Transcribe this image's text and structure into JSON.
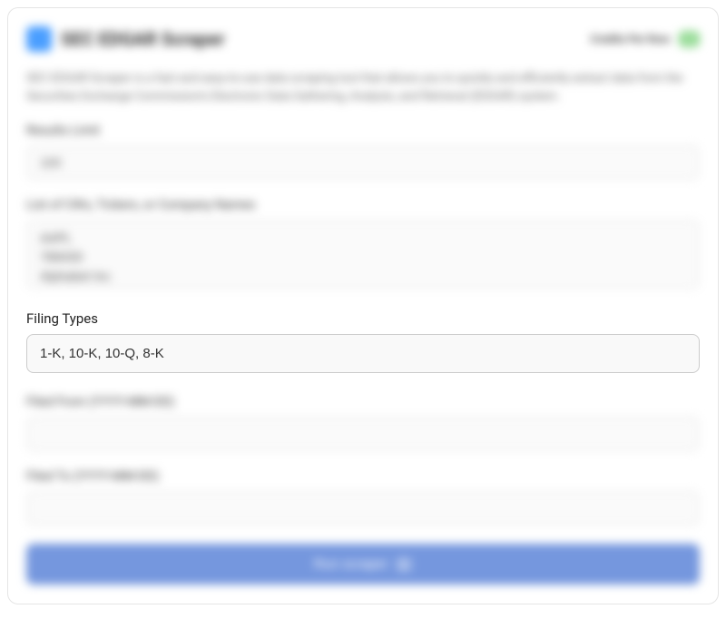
{
  "header": {
    "title": "SEC EDGAR Scraper",
    "credits_label": "Credits Per Row:",
    "credits_value": "1"
  },
  "description": "SEC EDGAR Scraper is a fast and easy-to-use data scraping tool that allows you to quickly and efficiently extract data from the Securities Exchange Commission's Electronic Data Gathering, Analysis, and Retrieval (EDGAR) system.",
  "fields": {
    "results_limit": {
      "label": "Results Limit",
      "value": "100"
    },
    "companies": {
      "label": "List of CIKs, Tickers, or Company Names",
      "value": "AAPL\n788430\nAlphabet Inc"
    },
    "filing_types": {
      "label": "Filing Types",
      "value": "1-K, 10-K, 10-Q, 8-K"
    },
    "filed_from": {
      "label": "Filed From (YYYY-MM-DD)",
      "value": ""
    },
    "filed_to": {
      "label": "Filed To (YYYY-MM-DD)",
      "value": ""
    }
  },
  "actions": {
    "run_label": "Run scraper",
    "run_badge": "1"
  }
}
